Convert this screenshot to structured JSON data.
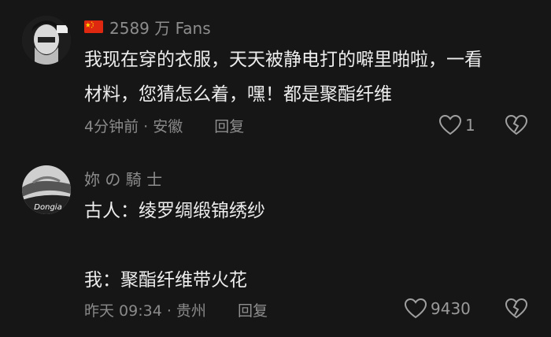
{
  "comments": [
    {
      "username": "2589 万 Fans",
      "text_lines": [
        "我现在穿的衣服，天天被静电打的噼里啪啦，一看",
        "材料，您猜怎么着，嘿！都是聚酯纤维"
      ],
      "meta": "4分钟前 · 安徽",
      "reply_label": "回复",
      "likes": "1"
    },
    {
      "username": "妳 の 騎 士",
      "text_lines": [
        "古人：绫罗绸缎锦绣纱",
        "",
        "我：聚酯纤维带火花"
      ],
      "meta": "昨天 09:34 · 贵州",
      "reply_label": "回复",
      "likes": "9430"
    }
  ],
  "colors": {
    "background": "#161616",
    "text": "#ededed",
    "secondary": "#8a8a8a",
    "flag_red": "#de2910",
    "flag_yellow": "#ffde00"
  },
  "icons": [
    "china-flag-icon",
    "heart-outline-icon",
    "broken-heart-icon"
  ]
}
